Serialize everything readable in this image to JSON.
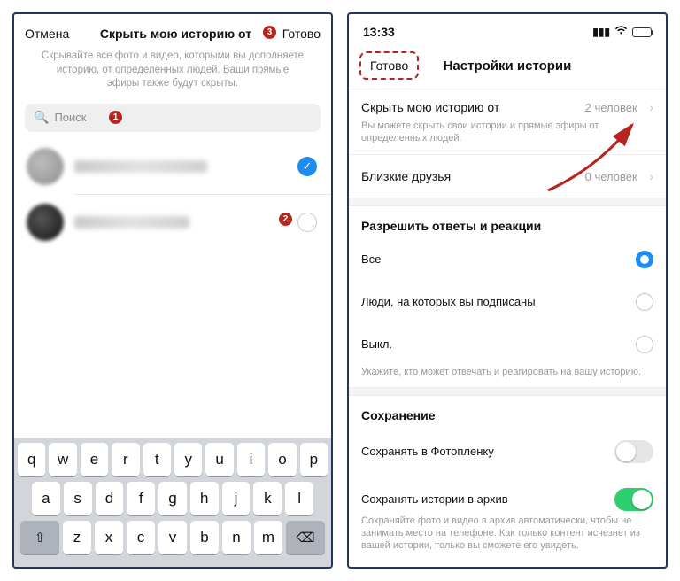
{
  "left": {
    "cancel": "Отмена",
    "title": "Скрыть мою историю от",
    "done": "Готово",
    "description": "Скрывайте все фото и видео, которыми вы дополняете историю, от определенных людей. Ваши прямые эфиры также будут скрыты.",
    "search_placeholder": "Поиск",
    "badge1": "1",
    "badge2": "2",
    "badge3": "3",
    "keyboard": {
      "row1": [
        "q",
        "w",
        "e",
        "r",
        "t",
        "y",
        "u",
        "i",
        "o",
        "p"
      ],
      "row2": [
        "a",
        "s",
        "d",
        "f",
        "g",
        "h",
        "j",
        "k",
        "l"
      ],
      "row3_shift": "⇧",
      "row3": [
        "z",
        "x",
        "c",
        "v",
        "b",
        "n",
        "m"
      ],
      "row3_del": "⌫"
    }
  },
  "right": {
    "time": "13:33",
    "done": "Готово",
    "title": "Настройки истории",
    "hide_label": "Скрыть мою историю от",
    "hide_value": "2 человек",
    "hide_hint": "Вы можете скрыть свои истории и прямые эфиры от определенных людей.",
    "close_friends_label": "Близкие друзья",
    "close_friends_value": "0 человек",
    "replies_title": "Разрешить ответы и реакции",
    "opt_all": "Все",
    "opt_following": "Люди, на которых вы подписаны",
    "opt_off": "Выкл.",
    "replies_hint": "Укажите, кто может отвечать и реагировать на вашу историю.",
    "save_title": "Сохранение",
    "save_camera": "Сохранять в Фотопленку",
    "save_archive": "Сохранять истории в архив",
    "archive_hint": "Сохраняйте фото и видео в архив автоматически, чтобы не занимать место на телефоне. Как только контент исчезнет из вашей истории, только вы сможете его увидеть."
  }
}
